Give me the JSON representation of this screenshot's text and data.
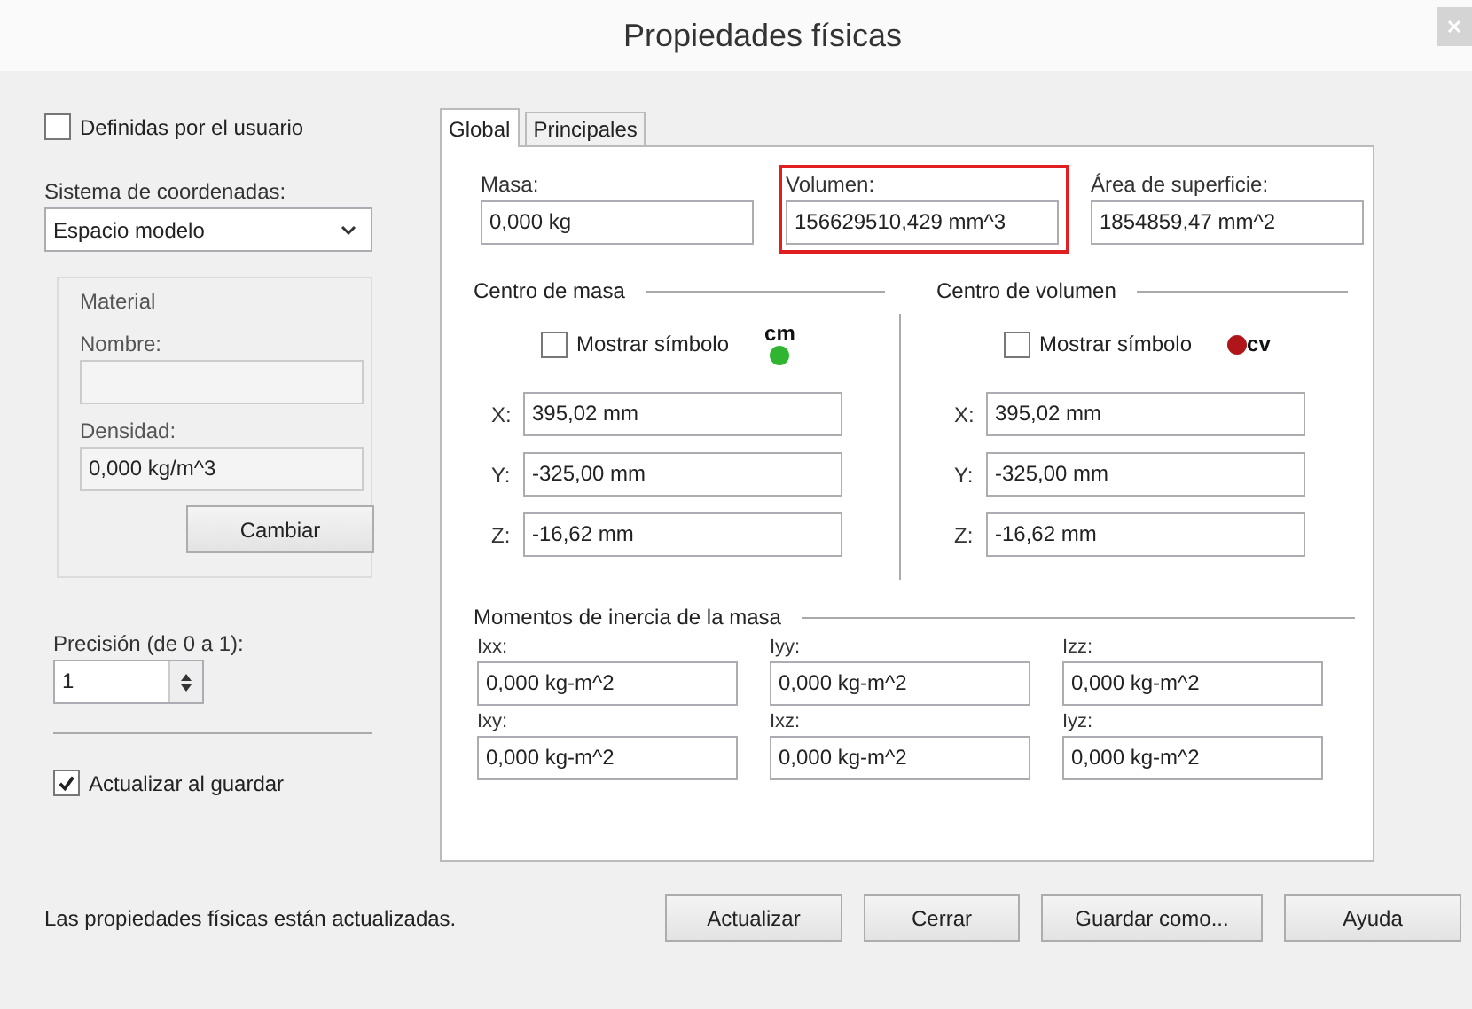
{
  "window": {
    "title": "Propiedades físicas"
  },
  "left": {
    "user_defined": {
      "label": "Definidas por el usuario",
      "checked": false
    },
    "coordinate_system": {
      "label": "Sistema de coordenadas:",
      "value": "Espacio modelo"
    },
    "material": {
      "title": "Material",
      "name": {
        "label": "Nombre:",
        "disabled": true
      },
      "density": {
        "label": "Densidad:",
        "value": "0,000 kg/m^3",
        "disabled": true
      },
      "change_button": "Cambiar"
    },
    "precision": {
      "label": "Precisión (de 0 a 1):",
      "value": "1"
    },
    "update_on_save": {
      "label": "Actualizar al guardar",
      "checked": true
    }
  },
  "tabs": [
    {
      "label": "Global",
      "selected": true
    },
    {
      "label": "Principales",
      "selected": false
    }
  ],
  "summary": [
    {
      "label": "Masa:",
      "value": "0,000 kg",
      "highlighted": false
    },
    {
      "label": "Volumen:",
      "value": "156629510,429 mm^3",
      "highlighted": true
    },
    {
      "label": "Área de superficie:",
      "value": "1854859,47 mm^2",
      "highlighted": false
    }
  ],
  "centers": [
    {
      "title": "Centro de masa",
      "show_symbol": {
        "label": "Mostrar símbolo",
        "checked": false
      },
      "symbol": {
        "text": "cm",
        "color": "#2fb52f"
      },
      "coords": [
        {
          "axis": "X:",
          "value": "395,02 mm"
        },
        {
          "axis": "Y:",
          "value": "-325,00 mm"
        },
        {
          "axis": "Z:",
          "value": "-16,62 mm"
        }
      ]
    },
    {
      "title": "Centro de volumen",
      "show_symbol": {
        "label": "Mostrar símbolo",
        "checked": false
      },
      "symbol": {
        "text": "cv",
        "color": "#b0151a"
      },
      "coords": [
        {
          "axis": "X:",
          "value": "395,02 mm"
        },
        {
          "axis": "Y:",
          "value": "-325,00 mm"
        },
        {
          "axis": "Z:",
          "value": "-16,62 mm"
        }
      ]
    }
  ],
  "inertia": {
    "title": "Momentos de inercia de la masa",
    "items": [
      {
        "label": "Ixx:",
        "value": "0,000 kg-m^2"
      },
      {
        "label": "Iyy:",
        "value": "0,000 kg-m^2"
      },
      {
        "label": "Izz:",
        "value": "0,000 kg-m^2"
      },
      {
        "label": "Ixy:",
        "value": "0,000 kg-m^2"
      },
      {
        "label": "Ixz:",
        "value": "0,000 kg-m^2"
      },
      {
        "label": "Iyz:",
        "value": "0,000 kg-m^2"
      }
    ]
  },
  "status": "Las propiedades físicas están actualizadas.",
  "buttons": [
    "Actualizar",
    "Cerrar",
    "Guardar como...",
    "Ayuda"
  ]
}
